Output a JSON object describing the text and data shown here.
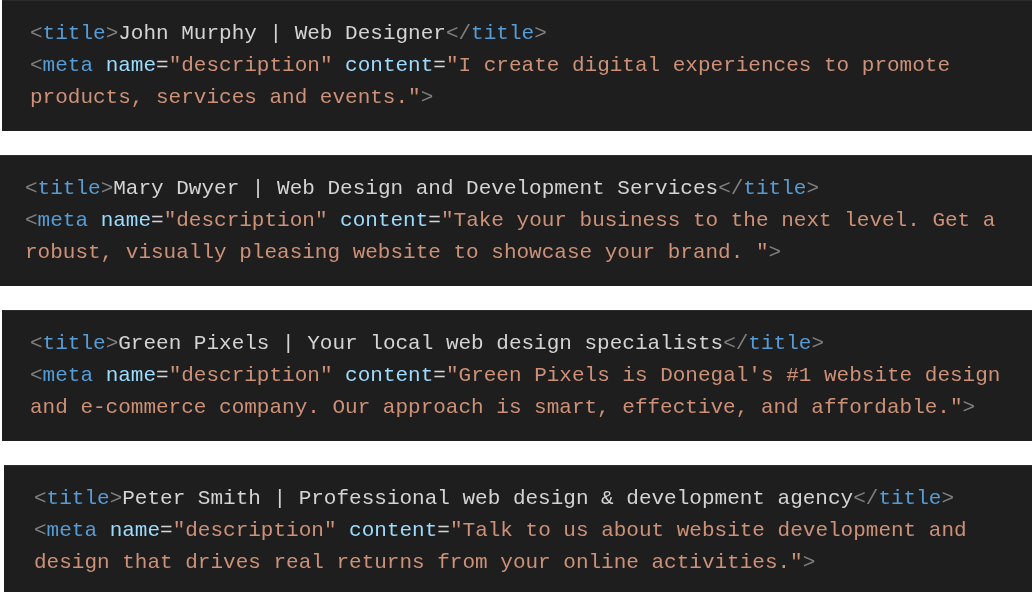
{
  "snippets": [
    {
      "lines": [
        [
          {
            "kind": "bracket",
            "text": "<"
          },
          {
            "kind": "tag",
            "text": "title"
          },
          {
            "kind": "bracket",
            "text": ">"
          },
          {
            "kind": "text",
            "text": "John Murphy | Web Designer"
          },
          {
            "kind": "bracket",
            "text": "</"
          },
          {
            "kind": "tag",
            "text": "title"
          },
          {
            "kind": "bracket",
            "text": ">"
          }
        ],
        [
          {
            "kind": "bracket",
            "text": "<"
          },
          {
            "kind": "tag",
            "text": "meta"
          },
          {
            "kind": "attr",
            "text": " name"
          },
          {
            "kind": "text",
            "text": "="
          },
          {
            "kind": "string",
            "text": "\"description\""
          },
          {
            "kind": "attr",
            "text": " content"
          },
          {
            "kind": "text",
            "text": "="
          },
          {
            "kind": "string",
            "text": "\"I create digital experiences to promote"
          }
        ],
        [
          {
            "kind": "string",
            "text": "products, services and events.\""
          },
          {
            "kind": "bracket",
            "text": ">"
          }
        ]
      ]
    },
    {
      "lines": [
        [
          {
            "kind": "bracket",
            "text": "<"
          },
          {
            "kind": "tag",
            "text": "title"
          },
          {
            "kind": "bracket",
            "text": ">"
          },
          {
            "kind": "text",
            "text": "Mary Dwyer | Web Design and Development Services"
          },
          {
            "kind": "bracket",
            "text": "</"
          },
          {
            "kind": "tag",
            "text": "title"
          },
          {
            "kind": "bracket",
            "text": ">"
          }
        ],
        [
          {
            "kind": "bracket",
            "text": "<"
          },
          {
            "kind": "tag",
            "text": "meta"
          },
          {
            "kind": "attr",
            "text": " name"
          },
          {
            "kind": "text",
            "text": "="
          },
          {
            "kind": "string",
            "text": "\"description\""
          },
          {
            "kind": "attr",
            "text": " content"
          },
          {
            "kind": "text",
            "text": "="
          },
          {
            "kind": "string",
            "text": "\"Take your business to the next level. Get a"
          }
        ],
        [
          {
            "kind": "string",
            "text": "robust, visually pleasing website to showcase your brand. \""
          },
          {
            "kind": "bracket",
            "text": ">"
          }
        ]
      ]
    },
    {
      "lines": [
        [
          {
            "kind": "bracket",
            "text": "<"
          },
          {
            "kind": "tag",
            "text": "title"
          },
          {
            "kind": "bracket",
            "text": ">"
          },
          {
            "kind": "text",
            "text": "Green Pixels | Your local web design specialists"
          },
          {
            "kind": "bracket",
            "text": "</"
          },
          {
            "kind": "tag",
            "text": "title"
          },
          {
            "kind": "bracket",
            "text": ">"
          }
        ],
        [
          {
            "kind": "bracket",
            "text": "<"
          },
          {
            "kind": "tag",
            "text": "meta"
          },
          {
            "kind": "attr",
            "text": " name"
          },
          {
            "kind": "text",
            "text": "="
          },
          {
            "kind": "string",
            "text": "\"description\""
          },
          {
            "kind": "attr",
            "text": " content"
          },
          {
            "kind": "text",
            "text": "="
          },
          {
            "kind": "string",
            "text": "\"Green Pixels is Donegal's #1 website design"
          }
        ],
        [
          {
            "kind": "string",
            "text": "and e-commerce company. Our approach is smart, effective, and affordable.\""
          },
          {
            "kind": "bracket",
            "text": ">"
          }
        ]
      ]
    },
    {
      "lines": [
        [
          {
            "kind": "bracket",
            "text": "<"
          },
          {
            "kind": "tag",
            "text": "title"
          },
          {
            "kind": "bracket",
            "text": ">"
          },
          {
            "kind": "text",
            "text": "Peter Smith | Professional web design & development agency"
          },
          {
            "kind": "bracket",
            "text": "</"
          },
          {
            "kind": "tag",
            "text": "title"
          },
          {
            "kind": "bracket",
            "text": ">"
          }
        ],
        [
          {
            "kind": "bracket",
            "text": "<"
          },
          {
            "kind": "tag",
            "text": "meta"
          },
          {
            "kind": "attr",
            "text": " name"
          },
          {
            "kind": "text",
            "text": "="
          },
          {
            "kind": "string",
            "text": "\"description\""
          },
          {
            "kind": "attr",
            "text": " content"
          },
          {
            "kind": "text",
            "text": "="
          },
          {
            "kind": "string",
            "text": "\"Talk to us about website development and"
          }
        ],
        [
          {
            "kind": "string",
            "text": "design that drives real returns from your online activities.\""
          },
          {
            "kind": "bracket",
            "text": ">"
          }
        ]
      ]
    }
  ]
}
